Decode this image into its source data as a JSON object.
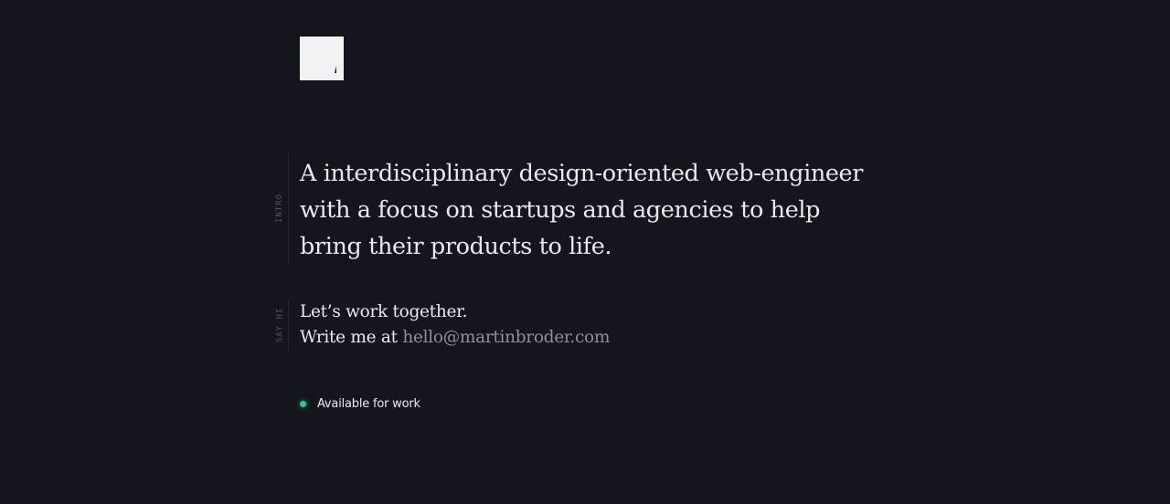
{
  "logo": {
    "icon": "monogram-m-logo",
    "color": "#f2f2f5"
  },
  "intro": {
    "label": "INTRO",
    "text": "A interdisciplinary design-oriented web-engineer with a focus on startups and agencies to help bring their products to life."
  },
  "say_hi": {
    "label": "SAY HI",
    "line1": "Let’s work together.",
    "line2_prefix": "Write me at",
    "email": "hello@martinbroder.com"
  },
  "status": {
    "text": "Available for work",
    "dot_color": "#1fd38a"
  },
  "colors": {
    "background": "#15151d",
    "text": "#e9e9ee",
    "muted": "#8f8f9c",
    "label": "#55555f"
  }
}
